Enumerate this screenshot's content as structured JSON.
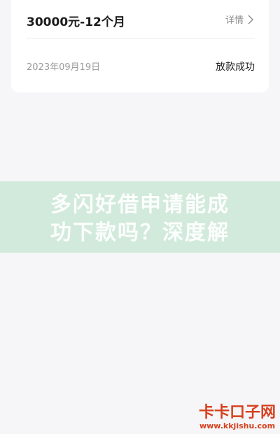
{
  "loan_card": {
    "amount_term": "30000元-12个月",
    "detail_label": "详情",
    "detail_icon": "chevron-right-icon",
    "date": "2023年09月19日",
    "status": "放款成功"
  },
  "overlay": {
    "line1": "多闪好借申请能成",
    "line2": "功下款吗？深度解"
  },
  "watermark": {
    "name": "卡卡口子网",
    "url": "www.kkjishu.com"
  },
  "colors": {
    "background": "#f6f6f9",
    "card": "#ffffff",
    "overlay": "#8ed4a4",
    "watermark": "#d5411f"
  }
}
